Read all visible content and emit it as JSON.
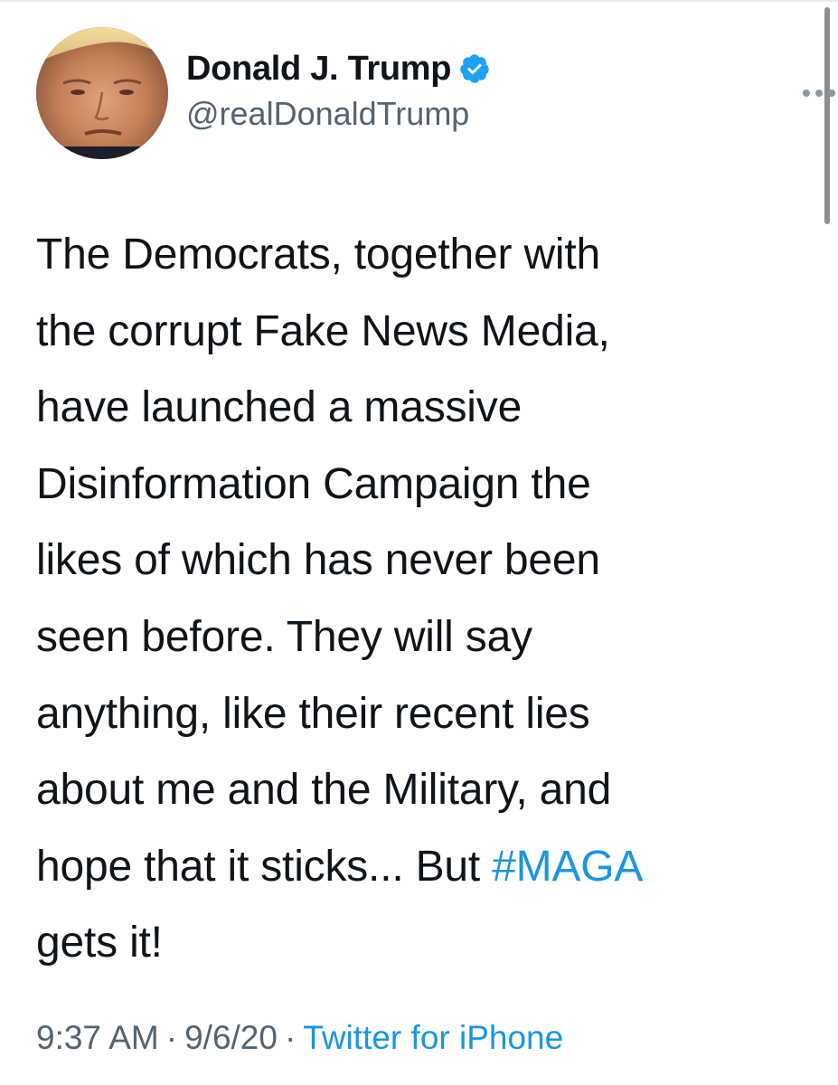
{
  "author": {
    "display_name": "Donald J. Trump",
    "handle": "@realDonaldTrump",
    "verified": true,
    "verified_color": "#1da1f2"
  },
  "tweet": {
    "lines": [
      "The Democrats, together with",
      "the corrupt Fake News Media,",
      "have launched a massive",
      "Disinformation Campaign the",
      "likes of which has never been",
      "seen before. They will say",
      "anything, like their recent lies",
      "about me and the Military, and"
    ],
    "line_9_prefix": "hope that it sticks... But ",
    "hashtag": "#MAGA",
    "line_10": "gets it!"
  },
  "meta": {
    "time": "9:37 AM",
    "separator": "·",
    "date": "9/6/20",
    "source": "Twitter for iPhone"
  },
  "icons": {
    "more": "more-horizontal-icon",
    "verified": "verified-badge-icon"
  },
  "colors": {
    "link": "#1b95e0",
    "secondary_text": "#536471",
    "primary_text": "#0f1419"
  }
}
